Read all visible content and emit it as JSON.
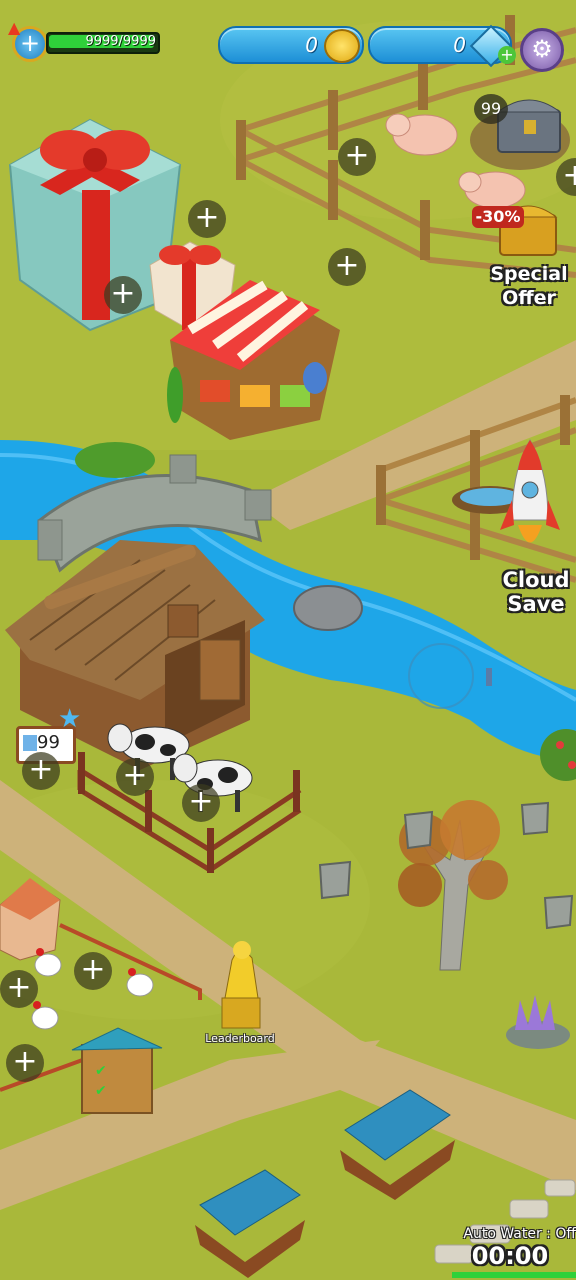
{
  "hud": {
    "xp_text": "9999/9999",
    "coins_value": "0",
    "gems_value": "0"
  },
  "offers": {
    "chest_count": "99",
    "discount_badge": "-30%",
    "special_offer_label": "Special\nOffer",
    "cloud_save_label": "Cloud\nSave"
  },
  "farm": {
    "barn_sign_value": "99",
    "leaderboard_label": "Leaderboard"
  },
  "footer": {
    "auto_water_label": "Auto Water : Off",
    "timer": "00:00"
  },
  "colors": {
    "grass": "#a9b83a",
    "river": "#1ea6e8",
    "path": "#cdb27a",
    "hud_blue": "#2a9be0",
    "xp_green": "#2fd13a"
  }
}
